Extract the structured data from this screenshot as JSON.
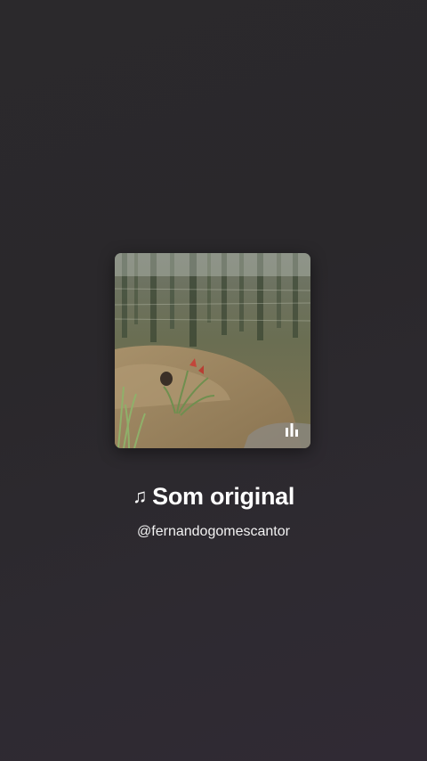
{
  "sound": {
    "note_icon": "music-note-icon",
    "note_glyph": "♫",
    "title": "Som original",
    "author": "@fernandogomescantor"
  },
  "cover": {
    "playing_indicator_icon": "equalizer-icon"
  }
}
